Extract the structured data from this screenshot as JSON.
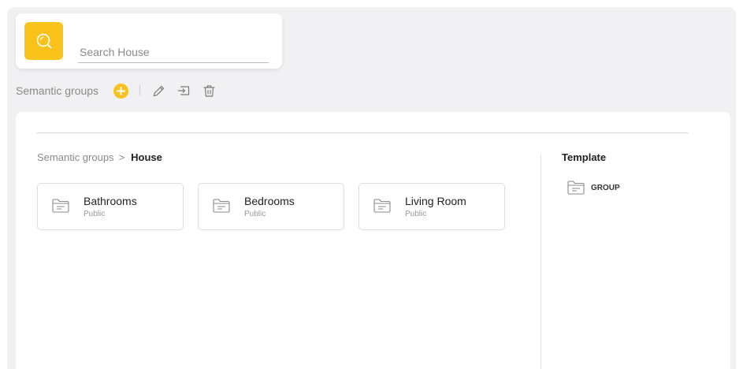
{
  "search": {
    "placeholder": "Search House",
    "value": ""
  },
  "toolbar": {
    "title": "Semantic groups"
  },
  "breadcrumb": {
    "parent": "Semantic groups",
    "separator": ">",
    "current": "House"
  },
  "groups": [
    {
      "name": "Bathrooms",
      "visibility": "Public"
    },
    {
      "name": "Bedrooms",
      "visibility": "Public"
    },
    {
      "name": "Living Room",
      "visibility": "Public"
    }
  ],
  "template": {
    "title": "Template",
    "items": [
      {
        "label": "GROUP"
      }
    ]
  },
  "colors": {
    "accent": "#f8c21b",
    "background": "#f1f0f2",
    "card": "#ffffff",
    "muted_text": "#8a8a8a"
  },
  "icons": {
    "search": "search-icon",
    "add": "plus-icon",
    "edit": "pencil-icon",
    "move": "move-to-icon",
    "delete": "trash-icon",
    "folder": "folder-icon"
  }
}
